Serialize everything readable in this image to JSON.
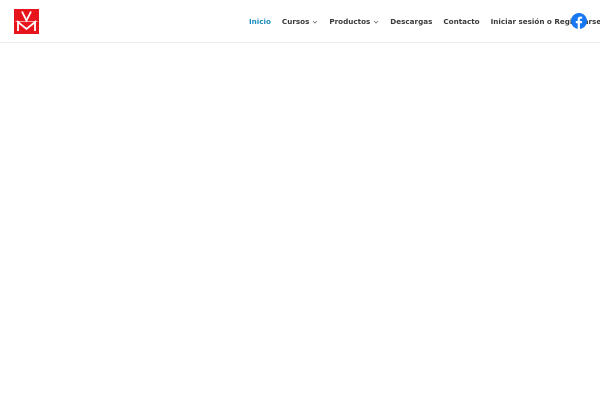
{
  "header": {
    "logo": {
      "letters": "VM",
      "color": "#e8141b"
    },
    "nav": [
      {
        "label": "Inicio",
        "active": true,
        "dropdown": false
      },
      {
        "label": "Cursos",
        "active": false,
        "dropdown": true
      },
      {
        "label": "Productos",
        "active": false,
        "dropdown": true
      },
      {
        "label": "Descargas",
        "active": false,
        "dropdown": false
      },
      {
        "label": "Contacto",
        "active": false,
        "dropdown": false
      },
      {
        "label": "Iniciar sesión o Registrarse",
        "active": false,
        "dropdown": false
      }
    ],
    "social": {
      "icon": "facebook-icon",
      "color": "#1877f2"
    }
  },
  "theme": {
    "accent": "#1e8cbe",
    "text": "#3a3a3a",
    "background": "#ffffff"
  }
}
